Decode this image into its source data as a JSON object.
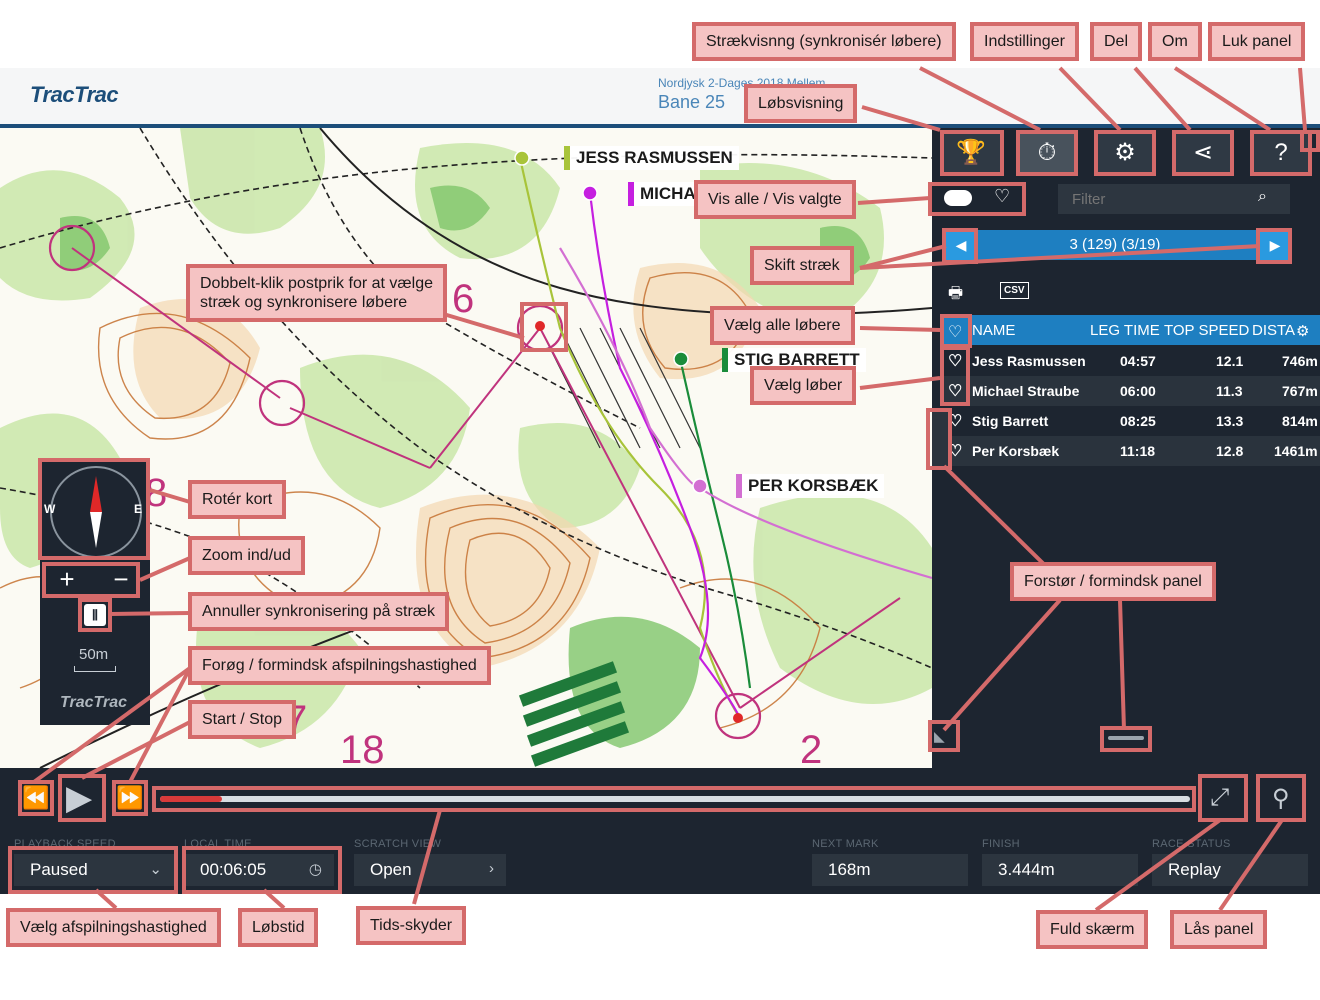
{
  "header": {
    "logo": "TracTrac",
    "event_subtitle": "Nordjysk 2-Dages 2018 Mellem",
    "event_title": "Bane 25"
  },
  "map": {
    "runner_labels": [
      {
        "name": "JESS RASMUSSEN",
        "color": "#a8c43a"
      },
      {
        "name": "MICHA",
        "color": "#c51fe0"
      },
      {
        "name": "STIG BARRETT",
        "color": "#1a8c3a"
      },
      {
        "name": "PER KORSBÆK",
        "color": "#d36fd2"
      }
    ],
    "control_numbers": [
      "6",
      "8",
      "7",
      "18",
      "2"
    ],
    "compass": {
      "west": "W",
      "east": "E"
    },
    "zoom_in": "+",
    "zoom_out": "−",
    "scale": "50m",
    "panel_logo": "TracTrac"
  },
  "panel": {
    "buttons": [
      {
        "name": "trophy",
        "glyph": "🏆"
      },
      {
        "name": "stopwatch",
        "glyph": "⏱"
      },
      {
        "name": "gear",
        "glyph": "⚙"
      },
      {
        "name": "share",
        "glyph": "⋖"
      },
      {
        "name": "help",
        "glyph": "?"
      }
    ],
    "filter_placeholder": "Filter",
    "leg_text": "3 (129) (3/19)",
    "print_glyph": "🖶",
    "csv_label": "CSV",
    "columns": [
      "NAME",
      "LEG TIME",
      "TOP SPEED",
      "DISTA"
    ],
    "rows": [
      {
        "name": "Jess Rasmussen",
        "leg_time": "04:57",
        "top_speed": "12.1",
        "distance": "746m"
      },
      {
        "name": "Michael Straube",
        "leg_time": "06:00",
        "top_speed": "11.3",
        "distance": "767m"
      },
      {
        "name": "Stig Barrett",
        "leg_time": "08:25",
        "top_speed": "13.3",
        "distance": "814m"
      },
      {
        "name": "Per Korsbæk",
        "leg_time": "11:18",
        "top_speed": "12.8",
        "distance": "1461m"
      }
    ]
  },
  "controls": {
    "rewind": "⏪",
    "play": "▶",
    "forward": "⏩",
    "fullscreen": "⤢",
    "lock": "⚲",
    "timeline_progress": 0.06,
    "fields": [
      {
        "label": "PLAYBACK SPEED",
        "value": "Paused",
        "icon": "⌄"
      },
      {
        "label": "LOCAL TIME",
        "value": "00:06:05",
        "icon": "◷"
      },
      {
        "label": "SCRATCH VIEW",
        "value": "Open",
        "icon": "›"
      },
      {
        "label": "NEXT MARK",
        "value": "168m",
        "icon": ""
      },
      {
        "label": "FINISH",
        "value": "3.444m",
        "icon": ""
      },
      {
        "label": "RACE STATUS",
        "value": "Replay",
        "icon": ""
      }
    ]
  },
  "callouts": {
    "leg_view": "Strækvisnng (synkronisér løbere)",
    "settings": "Indstillinger",
    "share": "Del",
    "about": "Om",
    "close_panel": "Luk panel",
    "race_view": "Løbsvisning",
    "show_all": "Vis alle / Vis valgte",
    "switch_leg": "Skift stræk",
    "double_click_line1": "Dobbelt-klik postprik for at vælge",
    "double_click_line2": "stræk og synkronisere løbere",
    "select_all": "Vælg alle løbere",
    "select_runner": "Vælg løber",
    "rotate_map": "Rotér kort",
    "zoom": "Zoom ind/ud",
    "cancel_sync": "Annuller synkronisering på stræk",
    "speed": "Forøg / formindsk afspilningshastighed",
    "start_stop": "Start / Stop",
    "resize_panel": "Forstør / formindsk panel",
    "choose_speed": "Vælg afspilningshastighed",
    "race_time": "Løbstid",
    "time_slider": "Tids-skyder",
    "fullscreen": "Fuld skærm",
    "lock_panel": "Lås panel"
  }
}
